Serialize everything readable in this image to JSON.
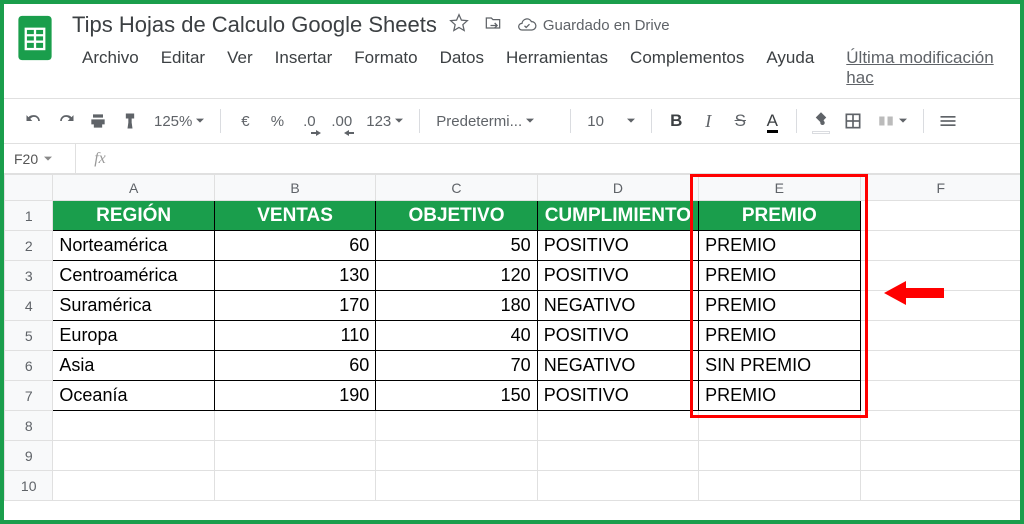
{
  "doc": {
    "title": "Tips Hojas de Calculo Google Sheets",
    "saved": "Guardado en Drive"
  },
  "menu": {
    "archivo": "Archivo",
    "editar": "Editar",
    "ver": "Ver",
    "insertar": "Insertar",
    "formato": "Formato",
    "datos": "Datos",
    "herramientas": "Herramientas",
    "complementos": "Complementos",
    "ayuda": "Ayuda",
    "last_mod": "Última modificación hac"
  },
  "toolbar": {
    "zoom": "125%",
    "currency": "€",
    "percent": "%",
    "dec_dec": ".0",
    "dec_inc": ".00",
    "numfmt": "123",
    "font": "Predetermi...",
    "fontsize": "10",
    "bold": "B",
    "italic": "I",
    "strike": "S",
    "textcolor": "A"
  },
  "namebox": {
    "ref": "F20"
  },
  "columns": [
    "A",
    "B",
    "C",
    "D",
    "E",
    "F"
  ],
  "rows": [
    "1",
    "2",
    "3",
    "4",
    "5",
    "6",
    "7",
    "8",
    "9",
    "10"
  ],
  "table": {
    "headers": {
      "region": "REGIÓN",
      "ventas": "VENTAS",
      "objetivo": "OBJETIVO",
      "cumplimiento": "CUMPLIMIENTO",
      "premio": "PREMIO"
    },
    "rows": [
      {
        "region": "Norteamérica",
        "ventas": "60",
        "objetivo": "50",
        "cumpl": "POSITIVO",
        "premio": "PREMIO"
      },
      {
        "region": "Centroamérica",
        "ventas": "130",
        "objetivo": "120",
        "cumpl": "POSITIVO",
        "premio": "PREMIO"
      },
      {
        "region": "Suramérica",
        "ventas": "170",
        "objetivo": "180",
        "cumpl": "NEGATIVO",
        "premio": "PREMIO"
      },
      {
        "region": "Europa",
        "ventas": "110",
        "objetivo": "40",
        "cumpl": "POSITIVO",
        "premio": "PREMIO"
      },
      {
        "region": "Asia",
        "ventas": "60",
        "objetivo": "70",
        "cumpl": "NEGATIVO",
        "premio": "SIN PREMIO"
      },
      {
        "region": "Oceanía",
        "ventas": "190",
        "objetivo": "150",
        "cumpl": "POSITIVO",
        "premio": "PREMIO"
      }
    ]
  }
}
